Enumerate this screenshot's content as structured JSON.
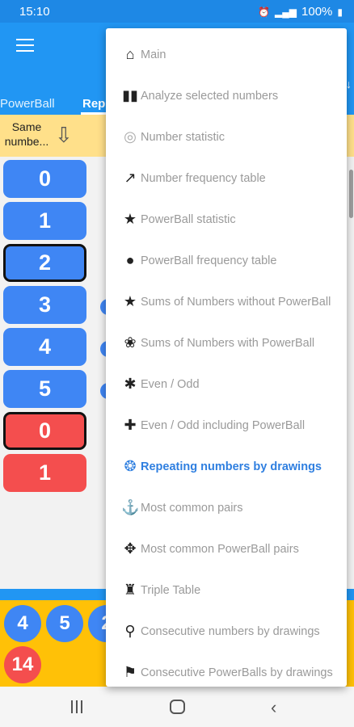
{
  "status_bar": {
    "time": "15:10",
    "battery": "100%",
    "icons": [
      "alarm-icon",
      "signal-icon",
      "battery-icon"
    ]
  },
  "tabs": {
    "tab1": "PowerBall",
    "tab2": "Repe"
  },
  "header": {
    "col1": "Same numbe...",
    "arrow": "⇩"
  },
  "rows": [
    {
      "label": "0",
      "color": "blue"
    },
    {
      "label": "1",
      "color": "blue"
    },
    {
      "label": "2",
      "color": "blue",
      "selected": true
    },
    {
      "label": "3",
      "color": "blue"
    },
    {
      "label": "4",
      "color": "blue"
    },
    {
      "label": "5",
      "color": "blue"
    },
    {
      "label": "0",
      "color": "red",
      "selected": true
    },
    {
      "label": "1",
      "color": "red"
    }
  ],
  "balls": [
    "4",
    "5",
    "2",
    "14"
  ],
  "menu": {
    "items": [
      {
        "label": "Main",
        "icon": "home-icon"
      },
      {
        "label": "Analyze selected numbers",
        "icon": "bar-chart-icon"
      },
      {
        "label": "Number statistic",
        "icon": "fingerprint-icon"
      },
      {
        "label": "Number frequency table",
        "icon": "trending-up-icon"
      },
      {
        "label": "PowerBall statistic",
        "icon": "star-icon"
      },
      {
        "label": "PowerBall frequency table",
        "icon": "piggy-bank-icon"
      },
      {
        "label": "Sums of Numbers without PowerBall",
        "icon": "star-icon"
      },
      {
        "label": "Sums of Numbers with PowerBall",
        "icon": "paw-icon"
      },
      {
        "label": "Even / Odd",
        "icon": "bug-icon"
      },
      {
        "label": "Even / Odd including PowerBall",
        "icon": "puzzle-icon"
      },
      {
        "label": "Repeating numbers by drawings",
        "icon": "brain-icon",
        "active": true
      },
      {
        "label": "Most common pairs",
        "icon": "anchor-icon"
      },
      {
        "label": "Most common PowerBall pairs",
        "icon": "gamepad-icon"
      },
      {
        "label": "Triple Table",
        "icon": "robot-arm-icon"
      },
      {
        "label": "Consecutive numbers by drawings",
        "icon": "scooter-icon"
      },
      {
        "label": "Consecutive PowerBalls by drawings",
        "icon": "flag-icon"
      }
    ]
  },
  "colors": {
    "primary": "#2196f3",
    "blue_button": "#3f86f4",
    "red_button": "#f44e4e",
    "yellow": "#ffc107",
    "active_text": "#2f7fe0"
  }
}
